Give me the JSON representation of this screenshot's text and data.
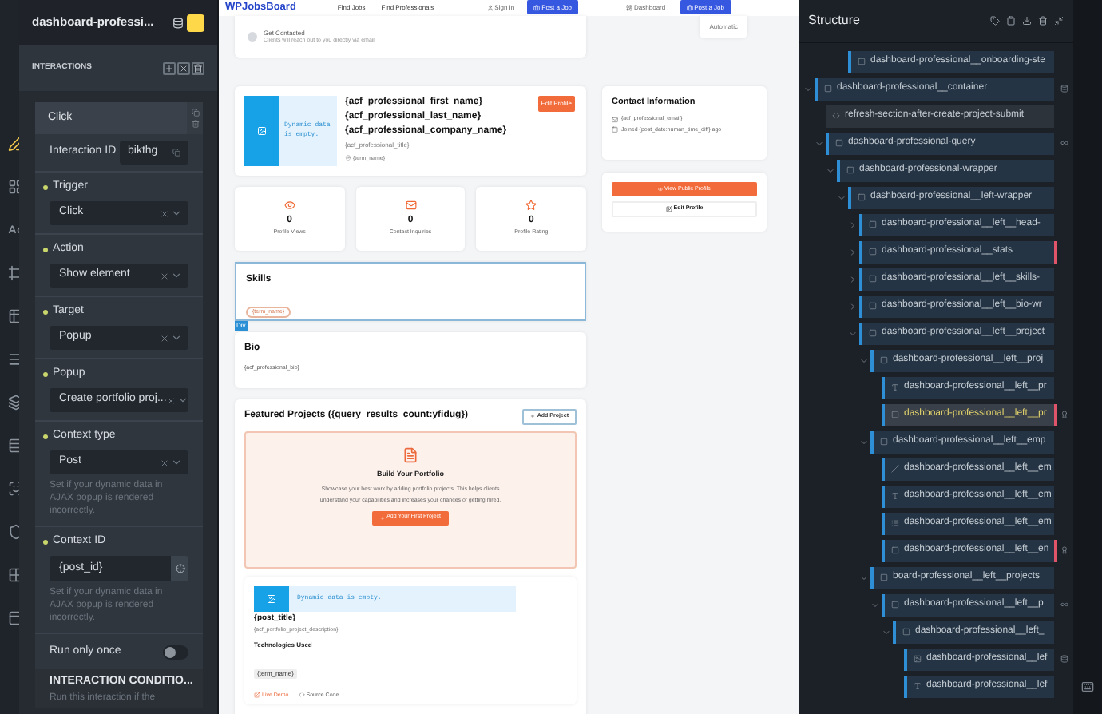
{
  "rail": [
    {
      "selected": true
    },
    {
      "selected": false
    },
    {
      "selected": false
    },
    {
      "selected": false
    },
    {
      "selected": false
    },
    {
      "selected": false
    },
    {
      "selected": false
    },
    {
      "selected": false
    },
    {
      "selected": false
    },
    {
      "selected": false
    },
    {
      "selected": false
    },
    {
      "selected": false
    }
  ],
  "left_panel": {
    "title": "dashboard-professi...",
    "section": "INTERACTIONS",
    "interaction": {
      "name": "Click",
      "id_label": "Interaction ID",
      "id_value": "bikthg",
      "fields": [
        {
          "kind": "select",
          "label": "Trigger",
          "value": "Click"
        },
        {
          "kind": "select",
          "label": "Action",
          "value": "Show element"
        },
        {
          "kind": "select",
          "label": "Target",
          "value": "Popup"
        },
        {
          "kind": "select",
          "label": "Popup",
          "value": "Create portfolio proj..."
        },
        {
          "kind": "select",
          "label": "Context type",
          "value": "Post",
          "help": "Set if your dynamic data in AJAX popup is rendered incorrectly."
        },
        {
          "kind": "input",
          "label": "Context ID",
          "value": "{post_id}",
          "help": "Set if your dynamic data in AJAX popup is rendered incorrectly."
        },
        {
          "kind": "toggle",
          "label": "Run only once",
          "on": false
        }
      ]
    },
    "conditions": {
      "title": "INTERACTION CONDITIO...",
      "text": "Run this interaction if the"
    }
  },
  "nav": {
    "logo": "WPJobsBoard",
    "links": [
      "Find Jobs",
      "Find Professionals"
    ],
    "sign_in": "Sign In",
    "post_job": "Post a Job",
    "dashboard": "Dashboard",
    "post_job_2": "Post a Job"
  },
  "onboarding": {
    "title": "Get Contacted",
    "text": "Clients will reach out to you directly via email",
    "aside": "Automatic"
  },
  "profile": {
    "placeholder": "Dynamic data is empty.",
    "names": [
      "{acf_professional_first_name}",
      "{acf_professional_last_name}",
      "{acf_professional_company_name}"
    ],
    "title": "{acf_professional_title}",
    "location": "{term_name}",
    "edit": "Edit Profile"
  },
  "stats": [
    {
      "kind": "views",
      "value": "0",
      "label": "Profile Views"
    },
    {
      "kind": "inquiries",
      "value": "0",
      "label": "Contact Inquiries"
    },
    {
      "kind": "rating",
      "value": "0",
      "label": "Profile Rating"
    }
  ],
  "skills": {
    "title": "Skills",
    "tag": "{term_name}",
    "selected": true,
    "badge": "Div"
  },
  "bio": {
    "title": "Bio",
    "text": "{acf_professional_bio}"
  },
  "projects": {
    "title": "Featured Projects ({query_results_count:yfidug})",
    "add": "Add Project",
    "empty": {
      "title": "Build Your Portfolio",
      "text": "Showcase your best work by adding portfolio projects. This helps clients understand your capabilities and increases your chances of getting hired.",
      "button": "Add Your First Project"
    },
    "item": {
      "placeholder": "Dynamic data is empty.",
      "title": "{post_title}",
      "description": "{acf_portfolio_project_description}",
      "tech_title": "Technologies Used",
      "tech": "{term_name}",
      "links": [
        "Live Demo",
        "Source Code"
      ]
    }
  },
  "contact": {
    "title": "Contact Information",
    "email": "{acf_professional_email}",
    "joined": "Joined {post_date:human_time_diff} ago"
  },
  "actions": {
    "view": "View Public Profile",
    "edit": "Edit Profile"
  },
  "structure": {
    "title": "Structure",
    "above": [
      {
        "label": "dashboard-professional__onboarding-ste",
        "kind": "box",
        "selected": false,
        "error": false
      }
    ],
    "items": [
      {
        "label": "dashboard-professional__container",
        "kind": "box",
        "expanded": true,
        "selected": false,
        "error": false,
        "marker": {
          "kind": "database"
        },
        "children": [
          {
            "label": "refresh-section-after-create-project-submit",
            "kind": "code",
            "selected": false,
            "error": false
          },
          {
            "label": "dashboard-professional-query",
            "kind": "box",
            "expanded": true,
            "selected": false,
            "error": false,
            "marker": {
              "kind": "loop"
            },
            "children": [
              {
                "label": "dashboard-professional-wrapper",
                "kind": "box",
                "expanded": true,
                "selected": false,
                "error": false,
                "children": [
                  {
                    "label": "dashboard-professional__left-wrapper",
                    "kind": "box",
                    "expanded": true,
                    "selected": false,
                    "error": false,
                    "children": [
                      {
                        "label": "dashboard-professional__left__head-",
                        "kind": "box",
                        "expanded": false,
                        "selected": false,
                        "error": false
                      },
                      {
                        "label": "dashboard-professional__stats",
                        "kind": "box",
                        "expanded": false,
                        "selected": false,
                        "error": true
                      },
                      {
                        "label": "dashboard-professional__left__skills-",
                        "kind": "box",
                        "expanded": false,
                        "selected": false,
                        "error": false
                      },
                      {
                        "label": "dashboard-professional__left__bio-wr",
                        "kind": "box",
                        "expanded": false,
                        "selected": false,
                        "error": false
                      },
                      {
                        "label": "dashboard-professional__left__project",
                        "kind": "box",
                        "expanded": true,
                        "selected": false,
                        "error": false,
                        "children": [
                          {
                            "label": "dashboard-professional__left__proj",
                            "kind": "box",
                            "expanded": true,
                            "selected": false,
                            "error": false,
                            "children": [
                              {
                                "label": "dashboard-professional__left__pr",
                                "kind": "text",
                                "selected": false,
                                "error": false
                              },
                              {
                                "label": "dashboard-professional__left__pr",
                                "kind": "box",
                                "selected": true,
                                "error": true,
                                "marker": {
                                  "kind": "badge"
                                }
                              }
                            ]
                          },
                          {
                            "label": "dashboard-professional__left__emp",
                            "kind": "box",
                            "expanded": true,
                            "selected": false,
                            "error": false,
                            "children": [
                              {
                                "label": "dashboard-professional__left__em",
                                "kind": "icon",
                                "selected": false,
                                "error": false
                              },
                              {
                                "label": "dashboard-professional__left__em",
                                "kind": "text",
                                "selected": false,
                                "error": false
                              },
                              {
                                "label": "dashboard-professional__left__em",
                                "kind": "list",
                                "selected": false,
                                "error": false
                              },
                              {
                                "label": "dashboard-professional__left__en",
                                "kind": "box",
                                "selected": false,
                                "error": true,
                                "marker": {
                                  "kind": "badge"
                                }
                              }
                            ]
                          },
                          {
                            "label": "board-professional__left__projects",
                            "kind": "box",
                            "expanded": true,
                            "selected": false,
                            "error": false,
                            "children": [
                              {
                                "label": "dashboard-professional__left__p",
                                "kind": "box",
                                "expanded": true,
                                "selected": false,
                                "error": false,
                                "marker": {
                                  "kind": "loop"
                                },
                                "children": [
                                  {
                                    "label": "dashboard-professional__left_",
                                    "kind": "box",
                                    "expanded": true,
                                    "selected": false,
                                    "error": false,
                                    "children": [
                                      {
                                        "label": "dashboard-professional__lef",
                                        "kind": "image",
                                        "selected": false,
                                        "error": false,
                                        "marker": {
                                          "kind": "database"
                                        }
                                      },
                                      {
                                        "label": "dashboard-professional__lef",
                                        "kind": "text",
                                        "selected": false,
                                        "error": false
                                      }
                                    ]
                                  }
                                ]
                              }
                            ]
                          }
                        ]
                      }
                    ]
                  }
                ]
              }
            ]
          }
        ]
      }
    ]
  }
}
